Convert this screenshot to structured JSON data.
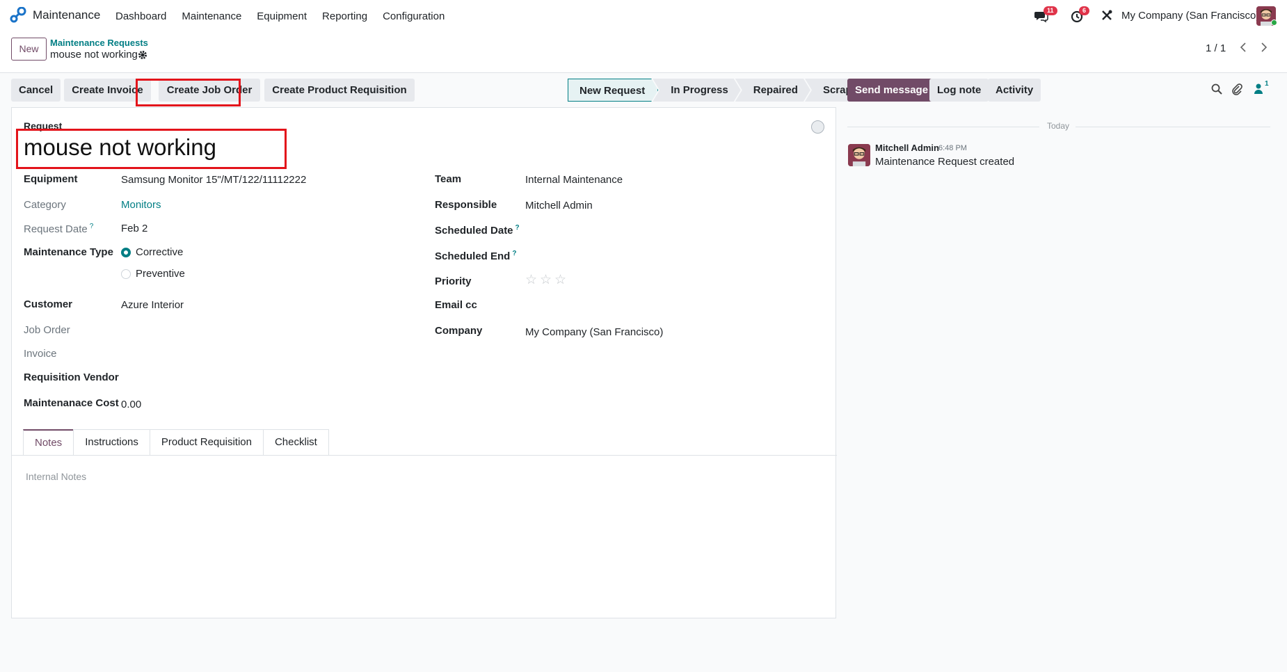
{
  "navbar": {
    "app_name": "Maintenance",
    "menu": [
      "Dashboard",
      "Maintenance",
      "Equipment",
      "Reporting",
      "Configuration"
    ],
    "messages_count": "11",
    "activities_count": "6",
    "company": "My Company (San Francisco)"
  },
  "control": {
    "new_label": "New",
    "breadcrumb_parent": "Maintenance Requests",
    "breadcrumb_current": "mouse not working",
    "pager": "1 / 1"
  },
  "actions": {
    "cancel": "Cancel",
    "create_invoice": "Create Invoice",
    "create_job_order": "Create Job Order",
    "create_product_requisition": "Create Product Requisition"
  },
  "stages": [
    "New Request",
    "In Progress",
    "Repaired",
    "Scrap"
  ],
  "form": {
    "request_label": "Request",
    "request_title": "mouse not working",
    "left": {
      "equipment_label": "Equipment",
      "equipment_value": "Samsung Monitor 15\"/MT/122/11112222",
      "category_label": "Category",
      "category_value": "Monitors",
      "request_date_label": "Request Date",
      "request_date_value": "Feb 2",
      "maintenance_type_label": "Maintenance Type",
      "type_options": [
        "Corrective",
        "Preventive"
      ],
      "type_selected": "Corrective",
      "customer_label": "Customer",
      "customer_value": "Azure Interior",
      "job_order_label": "Job Order",
      "invoice_label": "Invoice",
      "requisition_vendor_label": "Requisition Vendor",
      "maintenance_cost_label": "Maintenanace Cost",
      "maintenance_cost_value": "0.00"
    },
    "right": {
      "team_label": "Team",
      "team_value": "Internal Maintenance",
      "responsible_label": "Responsible",
      "responsible_value": "Mitchell Admin",
      "scheduled_date_label": "Scheduled Date",
      "scheduled_end_label": "Scheduled End",
      "priority_label": "Priority",
      "priority_stars": 0,
      "priority_max": 3,
      "email_cc_label": "Email cc",
      "company_label": "Company",
      "company_value": "My Company (San Francisco)"
    },
    "tabs": [
      "Notes",
      "Instructions",
      "Product Requisition",
      "Checklist"
    ],
    "active_tab": "Notes",
    "notes_placeholder": "Internal Notes"
  },
  "chatter": {
    "send_message": "Send message",
    "log_note": "Log note",
    "activity": "Activity",
    "followers_count": "1",
    "date_separator": "Today",
    "messages": [
      {
        "author": "Mitchell Admin",
        "time": "6:48 PM",
        "body": "Maintenance Request created"
      }
    ]
  },
  "colors": {
    "brand": "#714B67",
    "link": "#017e84",
    "highlight": "#e3141b"
  }
}
